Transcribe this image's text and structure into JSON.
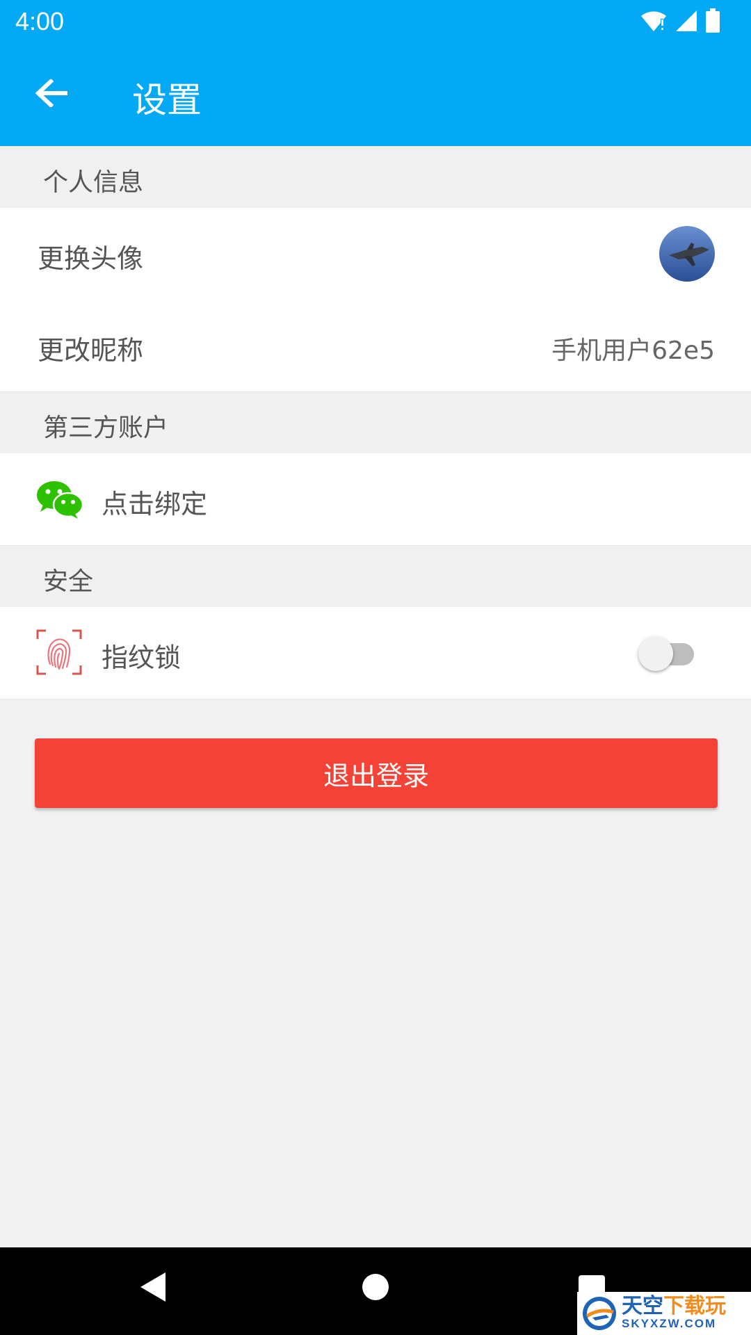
{
  "status_bar": {
    "time": "4:00"
  },
  "toolbar": {
    "title": "设置"
  },
  "sections": {
    "personal": {
      "header": "个人信息",
      "change_avatar": "更换头像",
      "change_nickname": "更改昵称",
      "nickname_value": "手机用户62e5"
    },
    "third_party": {
      "header": "第三方账户",
      "bind_label": "点击绑定"
    },
    "security": {
      "header": "安全",
      "fingerprint_label": "指纹锁",
      "fingerprint_enabled": false
    }
  },
  "logout_label": "退出登录",
  "watermark": {
    "top_main": "天空",
    "top_accent": "下载玩",
    "bottom": "SKYXZW.COM"
  },
  "colors": {
    "primary": "#03a9f4",
    "danger": "#f44336",
    "wechat": "#2dc100",
    "fingerprint": "#d9534f"
  }
}
